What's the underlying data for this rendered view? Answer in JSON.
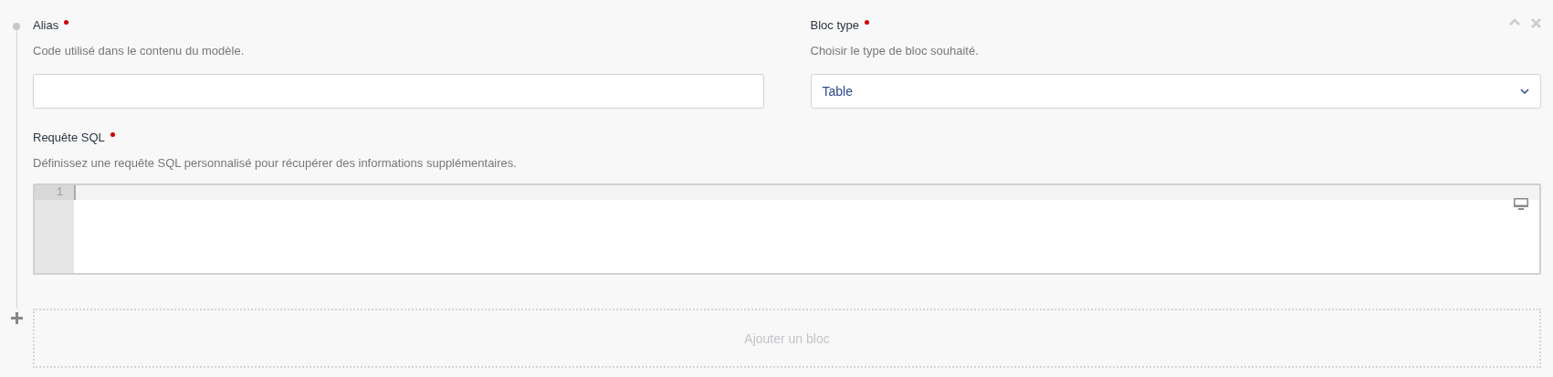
{
  "fields": [
    {
      "label": "Alias",
      "required": true,
      "description": "Code utilisé dans le contenu du modèle.",
      "kind": "text"
    },
    {
      "label": "Bloc type",
      "required": true,
      "description": "Choisir le type de bloc souhaité.",
      "kind": "select",
      "value": "Table"
    }
  ],
  "sql": {
    "label": "Requête SQL",
    "required": true,
    "description": "Définissez une requête SQL personnalisé pour récupérer des informations supplémentaires.",
    "line_numbers": [
      "1"
    ]
  },
  "add_block": {
    "label": "Ajouter un bloc"
  }
}
